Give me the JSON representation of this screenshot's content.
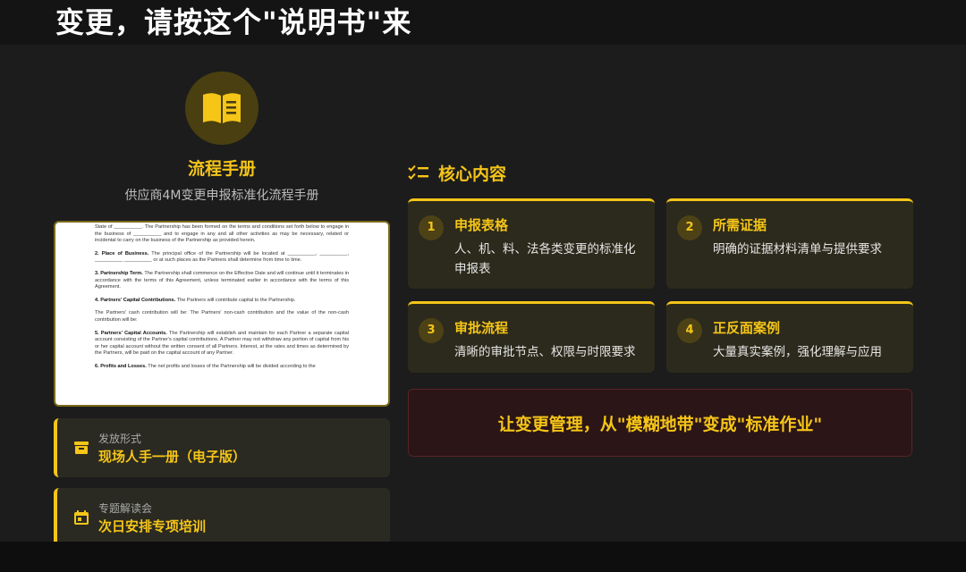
{
  "header": {
    "title": "变更，请按这个\"说明书\"来"
  },
  "manual": {
    "icon": "book-icon",
    "title": "流程手册",
    "subtitle": "供应商4M变更申报标准化流程手册",
    "document_preview": [
      {
        "heading": "",
        "text": "State of __________. The Partnership has been formed on the terms and conditions set forth below to engage in the business of __________ and to engage in any and all other activities as may be necessary, related or incidental to carry on the business of the Partnership as provided herein."
      },
      {
        "heading": "2.  Place of Business.",
        "text": "The principal office of the Partnership will be located at __________, __________, __________ __________ or at such places as the Partners shall determine from time to time."
      },
      {
        "heading": "3.  Partnership Term.",
        "text": "The Partnership shall commence on the Effective Date and will continue until it terminates in accordance with the terms of this Agreement, unless terminated earlier in accordance with the terms of this Agreement."
      },
      {
        "heading": "4.  Partners' Capital Contributions.",
        "text": "The Partners will contribute capital to the Partnership."
      },
      {
        "heading": "",
        "text": "The Partners' cash contribution will be: The Partners' non-cash contribution and the value of the non-cash contribution will be:"
      },
      {
        "heading": "5.  Partners' Capital Accounts.",
        "text": "The Partnership will establish and maintain for each Partner a separate capital account consisting of the Partner's capital contributions. A Partner may not withdraw any portion of capital from his or her capital account without the written consent of all Partners. Interest, at the rates and times as determined by the Partners, will be paid on the capital account of any Partner."
      },
      {
        "heading": "6.  Profits and Losses.",
        "text": "The net profits and losses of the Partnership will be divided according to the"
      }
    ]
  },
  "info_cards": [
    {
      "icon": "archive-icon",
      "label": "发放形式",
      "value": "现场人手一册（电子版）"
    },
    {
      "icon": "calendar-icon",
      "label": "专题解读会",
      "value": "次日安排专项培训"
    }
  ],
  "core": {
    "icon": "checklist-icon",
    "title": "核心内容",
    "items": [
      {
        "num": "1",
        "title": "申报表格",
        "desc": "人、机、料、法各类变更的标准化申报表"
      },
      {
        "num": "2",
        "title": "所需证据",
        "desc": "明确的证据材料清单与提供要求"
      },
      {
        "num": "3",
        "title": "审批流程",
        "desc": "清晰的审批节点、权限与时限要求"
      },
      {
        "num": "4",
        "title": "正反面案例",
        "desc": "大量真实案例，强化理解与应用"
      }
    ]
  },
  "banner": {
    "text": "让变更管理，从\"模糊地带\"变成\"标准作业\""
  },
  "colors": {
    "accent": "#f5c518",
    "background": "#1c1c1c",
    "banner_bg": "#2b1516"
  }
}
